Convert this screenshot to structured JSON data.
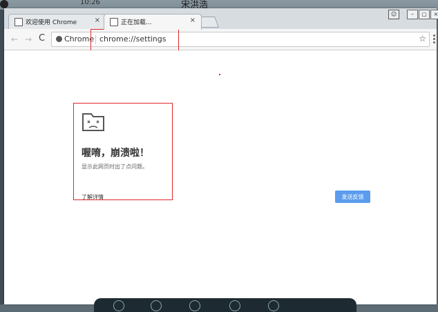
{
  "desktop": {
    "time": "10:26",
    "name": "宋洪浩"
  },
  "tabs": [
    {
      "title": "欢迎使用 Chrome",
      "close": "×"
    },
    {
      "title": "正在加载...",
      "close": "×"
    }
  ],
  "toolbar": {
    "back": "←",
    "forward": "→",
    "reload": "C",
    "chip_label": "Chrome",
    "url": "chrome://settings",
    "star": "☆"
  },
  "crash_page": {
    "title": "喔唷，崩溃啦！",
    "message": "显示此网页时出了点问题。",
    "learn_more": "了解详情",
    "feedback_button": "发送反馈"
  },
  "colors": {
    "highlight": "#e1262a",
    "feedback_button": "#5b9ced"
  }
}
